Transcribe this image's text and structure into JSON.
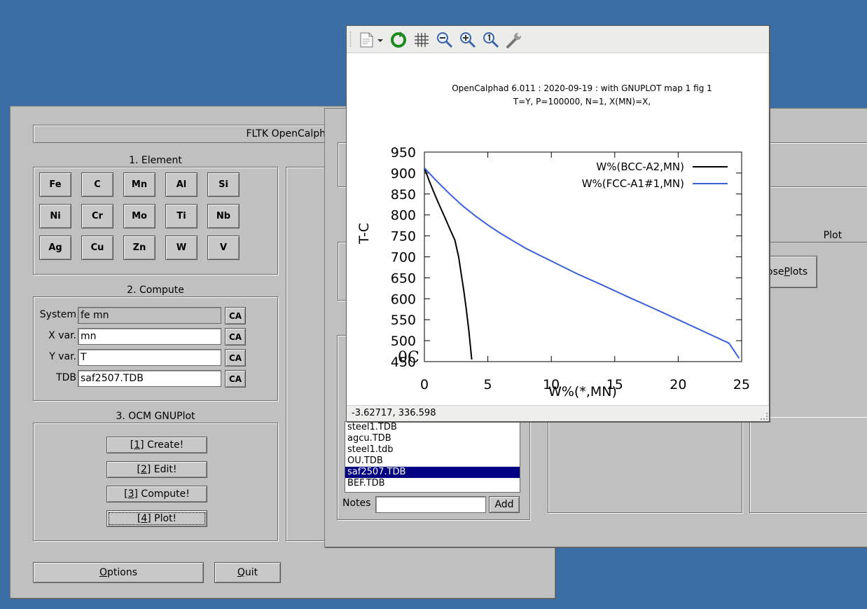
{
  "main_window": {
    "title_bar": "FLTK OpenCalphad",
    "element_section": "1. Element",
    "elements": [
      [
        "Fe",
        "C",
        "Mn",
        "Al",
        "Si"
      ],
      [
        "Ni",
        "Cr",
        "Mo",
        "Ti",
        "Nb"
      ],
      [
        "Ag",
        "Cu",
        "Zn",
        "W",
        "V"
      ]
    ],
    "compute_section": "2. Compute",
    "fields": [
      {
        "label": "System",
        "value": "fe mn",
        "ca": "CA"
      },
      {
        "label": "X var.",
        "value": "mn",
        "ca": "CA"
      },
      {
        "label": "Y var.",
        "value": "T",
        "ca": "CA"
      },
      {
        "label": "TDB",
        "value": "saf2507.TDB",
        "ca": "CA"
      }
    ],
    "gnuplot_section": "3. OCM GNUPlot",
    "actions": {
      "create": {
        "prefix": "[",
        "key": "1",
        "suffix": "] Create!"
      },
      "edit": {
        "prefix": "[",
        "key": "2",
        "suffix": "] Edit!"
      },
      "compute": {
        "prefix": "[",
        "key": "3",
        "suffix": "] Compute!"
      },
      "plot": {
        "prefix": "[",
        "key": "4",
        "suffix": "] Plot!"
      }
    },
    "options": {
      "key": "O",
      "rest": "ptions"
    },
    "quit": {
      "key": "Q",
      "rest": "uit"
    }
  },
  "second_window": {
    "plot_section": "Plot",
    "close_plots": {
      "pre": "ose ",
      "key": "P",
      "rest": "lots"
    },
    "tdb_list": [
      "steel1.TDB",
      "agcu.TDB",
      "steel1.tdb",
      "OU.TDB",
      "saf2507.TDB",
      "BEF.TDB"
    ],
    "selected_index": 4,
    "notes_label": "Notes",
    "add_button": "Add"
  },
  "gnuplot_window": {
    "status_coords": "-3.62717,  336.598",
    "toolbar_icons": [
      "export-icon",
      "dropdown-arrow-icon",
      "replot-icon",
      "grid-icon",
      "zoom-prev-icon",
      "zoom-next-icon",
      "unzoom-icon",
      "settings-icon"
    ]
  },
  "chart_data": {
    "type": "line",
    "title": "OpenCalphad   6.011 :  2020-09-19 : with GNUPLOT map 1 fig 1",
    "subtitle": "T=Y,  P=100000, N=1, X(MN)=X,",
    "xlabel": "W%(*,MN)",
    "ylabel": "T-C",
    "corner_label": "0C",
    "xlim": [
      0,
      25
    ],
    "ylim": [
      450,
      950
    ],
    "xticks": [
      0,
      5,
      10,
      15,
      20,
      25
    ],
    "yticks": [
      450,
      500,
      550,
      600,
      650,
      700,
      750,
      800,
      850,
      900,
      950
    ],
    "legend_position": "top-right",
    "series": [
      {
        "name": "W%(BCC-A2,MN)",
        "color": "#000000",
        "x": [
          0.0,
          0.4,
          0.8,
          1.2,
          1.6,
          2.0,
          2.4,
          2.7,
          2.9,
          3.1,
          3.3,
          3.5,
          3.65,
          3.73
        ],
        "y": [
          912,
          880,
          850,
          822,
          795,
          767,
          740,
          700,
          660,
          620,
          575,
          525,
          480,
          455
        ]
      },
      {
        "name": "W%(FCC-A1#1,MN)",
        "color": "#3a5fd8",
        "x": [
          0.0,
          1,
          2,
          3,
          4,
          5,
          6,
          7,
          8,
          10,
          12,
          14,
          16,
          18,
          20,
          22,
          24,
          24.8
        ],
        "y": [
          912,
          880,
          850,
          822,
          798,
          776,
          756,
          738,
          720,
          690,
          660,
          633,
          605,
          578,
          550,
          522,
          494,
          458
        ]
      }
    ]
  }
}
